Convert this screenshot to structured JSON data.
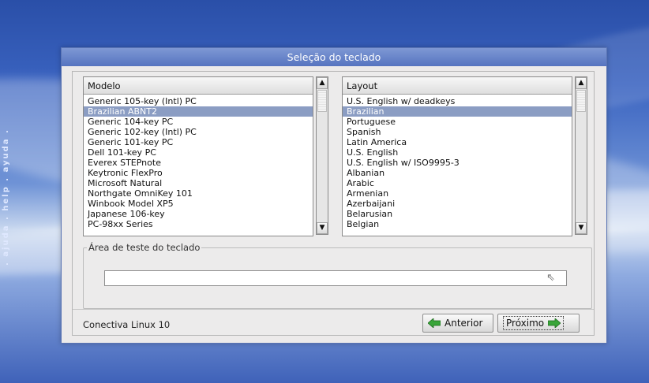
{
  "sidebar": {
    "text": ". ajuda . help . ayuda ."
  },
  "dialog": {
    "title": "Seleção do teclado",
    "model_list": {
      "header": "Modelo",
      "items": [
        "Generic 105-key (Intl) PC",
        "Brazilian ABNT2",
        "Generic 104-key PC",
        "Generic 102-key (Intl) PC",
        "Generic 101-key PC",
        "Dell 101-key PC",
        "Everex STEPnote",
        "Keytronic FlexPro",
        "Microsoft Natural",
        "Northgate OmniKey 101",
        "Winbook Model XP5",
        "Japanese 106-key",
        "PC-98xx Series"
      ],
      "selected_index": 1
    },
    "layout_list": {
      "header": "Layout",
      "items": [
        "U.S. English w/ deadkeys",
        "Brazilian",
        "Portuguese",
        "Spanish",
        "Latin America",
        "U.S. English",
        "U.S. English w/ ISO9995-3",
        "Albanian",
        "Arabic",
        "Armenian",
        "Azerbaijani",
        "Belarusian",
        "Belgian"
      ],
      "selected_index": 1
    },
    "test_area": {
      "legend": "Área de teste do teclado",
      "value": ""
    },
    "footer": {
      "product": "Conectiva Linux 10",
      "prev_label": "Anterior",
      "next_label": "Próximo"
    }
  },
  "colors": {
    "selection": "#8b9dc3",
    "title_bar": "#5674c0",
    "arrow_green": "#3aa53a"
  }
}
